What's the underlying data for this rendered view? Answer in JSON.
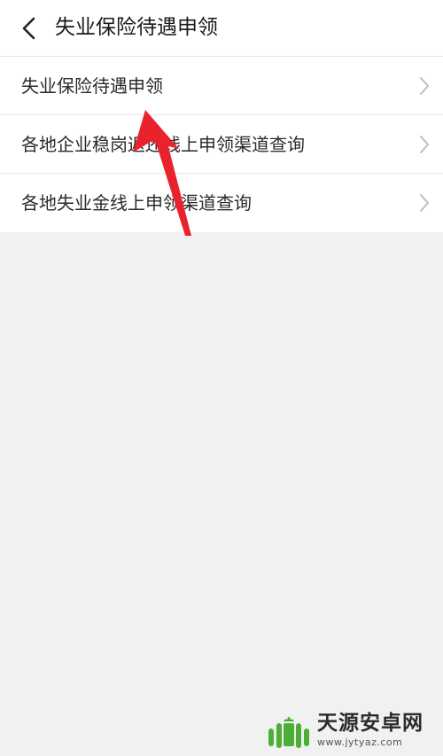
{
  "header": {
    "title": "失业保险待遇申领",
    "back_icon": "chevron-left-icon"
  },
  "list": {
    "items": [
      {
        "label": "失业保险待遇申领",
        "icon": "chevron-right-icon"
      },
      {
        "label": "各地企业稳岗返还线上申领渠道查询",
        "icon": "chevron-right-icon"
      },
      {
        "label": "各地失业金线上申领渠道查询",
        "icon": "chevron-right-icon"
      }
    ]
  },
  "annotation": {
    "type": "red-arrow",
    "points_to": "失业保险待遇申领",
    "color": "#e8232b"
  },
  "watermark": {
    "name": "天源安卓网",
    "url": "www.jytyaz.com",
    "logo_color": "#4caf35"
  },
  "colors": {
    "background": "#f1f1f1",
    "surface": "#ffffff",
    "divider": "#e6e6e6",
    "text": "#2a2a2a",
    "chevron": "#bdbdbd"
  }
}
